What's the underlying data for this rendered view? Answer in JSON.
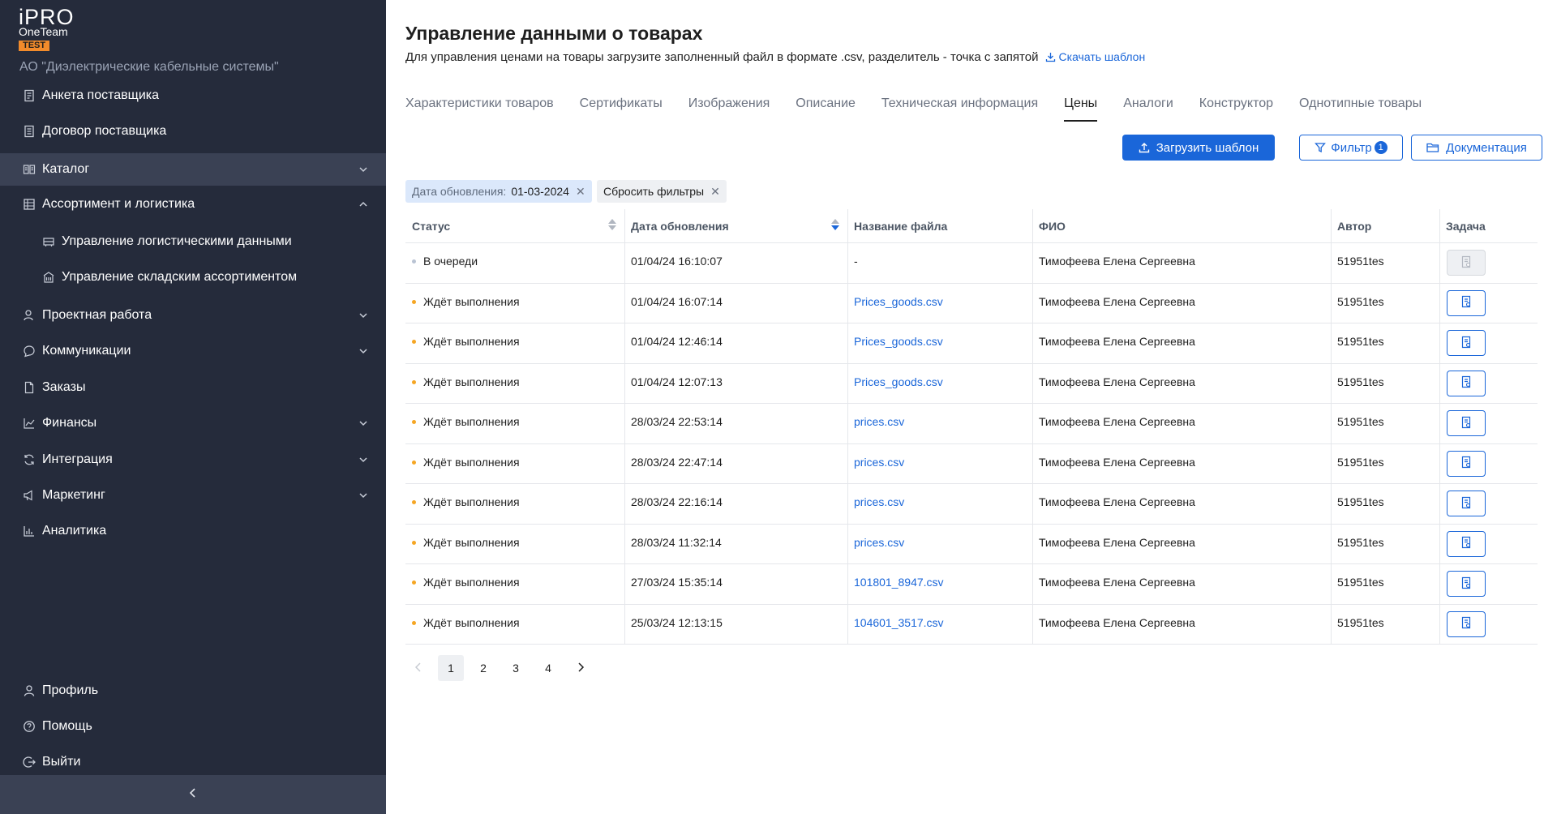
{
  "app": {
    "logo_line1": "iPRO",
    "logo_line2": "OneTeam",
    "logo_badge": "TEST",
    "company": "АО \"Диэлектрические кабельные системы\""
  },
  "sidebar": {
    "items": [
      {
        "label": "Анкета поставщика",
        "icon": "form-icon"
      },
      {
        "label": "Договор поставщика",
        "icon": "contract-icon"
      },
      {
        "label": "Каталог",
        "icon": "catalog-icon",
        "expandable": true,
        "active": true
      },
      {
        "label": "Ассортимент и логистика",
        "icon": "warehouse-icon",
        "expandable": true,
        "expanded": true
      },
      {
        "label": "Управление логистическими данными",
        "icon": "truck-icon",
        "sub": true
      },
      {
        "label": "Управление складским ассортиментом",
        "icon": "building-icon",
        "sub": true
      },
      {
        "label": "Проектная работа",
        "icon": "project-icon",
        "expandable": true
      },
      {
        "label": "Коммуникации",
        "icon": "chat-icon",
        "expandable": true
      },
      {
        "label": "Заказы",
        "icon": "document-icon"
      },
      {
        "label": "Финансы",
        "icon": "finance-icon",
        "expandable": true
      },
      {
        "label": "Интеграция",
        "icon": "sync-icon",
        "expandable": true
      },
      {
        "label": "Маркетинг",
        "icon": "megaphone-icon",
        "expandable": true
      },
      {
        "label": "Аналитика",
        "icon": "bar-chart-icon"
      }
    ],
    "bottom": [
      {
        "label": "Профиль",
        "icon": "user-icon"
      },
      {
        "label": "Помощь",
        "icon": "help-icon"
      },
      {
        "label": "Выйти",
        "icon": "logout-icon"
      }
    ]
  },
  "header": {
    "title": "Управление данными о товарах",
    "subtitle": "Для управления ценами на товары загрузите заполненный файл в формате .csv, разделитель - точка с запятой",
    "download_template": "Скачать шаблон"
  },
  "tabs": [
    {
      "label": "Характеристики товаров"
    },
    {
      "label": "Сертификаты"
    },
    {
      "label": "Изображения"
    },
    {
      "label": "Описание"
    },
    {
      "label": "Техническая информация"
    },
    {
      "label": "Цены",
      "active": true
    },
    {
      "label": "Аналоги"
    },
    {
      "label": "Конструктор"
    },
    {
      "label": "Однотипные товары"
    }
  ],
  "toolbar": {
    "upload_label": "Загрузить шаблон",
    "filter_label": "Фильтр",
    "filter_count": "1",
    "docs_label": "Документация"
  },
  "filters": {
    "chip_key": "Дата обновления:",
    "chip_value": "01-03-2024",
    "reset_label": "Сбросить фильтры"
  },
  "table": {
    "columns": [
      "Статус",
      "Дата обновления",
      "Название файла",
      "ФИО",
      "Автор",
      "Задача"
    ],
    "rows": [
      {
        "status": "В очереди",
        "status_color": "#b9c3d3",
        "date": "01/04/24 16:10:07",
        "file": "-",
        "file_link": false,
        "fio": "Тимофеева Елена Сергеевна",
        "author": "51951tes",
        "task_enabled": false
      },
      {
        "status": "Ждёт выполнения",
        "status_color": "#f5a623",
        "date": "01/04/24 16:07:14",
        "file": "Prices_goods.csv",
        "file_link": true,
        "fio": "Тимофеева Елена Сергеевна",
        "author": "51951tes",
        "task_enabled": true
      },
      {
        "status": "Ждёт выполнения",
        "status_color": "#f5a623",
        "date": "01/04/24 12:46:14",
        "file": "Prices_goods.csv",
        "file_link": true,
        "fio": "Тимофеева Елена Сергеевна",
        "author": "51951tes",
        "task_enabled": true
      },
      {
        "status": "Ждёт выполнения",
        "status_color": "#f5a623",
        "date": "01/04/24 12:07:13",
        "file": "Prices_goods.csv",
        "file_link": true,
        "fio": "Тимофеева Елена Сергеевна",
        "author": "51951tes",
        "task_enabled": true
      },
      {
        "status": "Ждёт выполнения",
        "status_color": "#f5a623",
        "date": "28/03/24 22:53:14",
        "file": "prices.csv",
        "file_link": true,
        "fio": "Тимофеева Елена Сергеевна",
        "author": "51951tes",
        "task_enabled": true
      },
      {
        "status": "Ждёт выполнения",
        "status_color": "#f5a623",
        "date": "28/03/24 22:47:14",
        "file": "prices.csv",
        "file_link": true,
        "fio": "Тимофеева Елена Сергеевна",
        "author": "51951tes",
        "task_enabled": true
      },
      {
        "status": "Ждёт выполнения",
        "status_color": "#f5a623",
        "date": "28/03/24 22:16:14",
        "file": "prices.csv",
        "file_link": true,
        "fio": "Тимофеева Елена Сергеевна",
        "author": "51951tes",
        "task_enabled": true
      },
      {
        "status": "Ждёт выполнения",
        "status_color": "#f5a623",
        "date": "28/03/24 11:32:14",
        "file": "prices.csv",
        "file_link": true,
        "fio": "Тимофеева Елена Сергеевна",
        "author": "51951tes",
        "task_enabled": true
      },
      {
        "status": "Ждёт выполнения",
        "status_color": "#f5a623",
        "date": "27/03/24 15:35:14",
        "file": "101801_8947.csv",
        "file_link": true,
        "fio": "Тимофеева Елена Сергеевна",
        "author": "51951tes",
        "task_enabled": true
      },
      {
        "status": "Ждёт выполнения",
        "status_color": "#f5a623",
        "date": "25/03/24 12:13:15",
        "file": "104601_3517.csv",
        "file_link": true,
        "fio": "Тимофеева Елена Сергеевна",
        "author": "51951tes",
        "task_enabled": true
      }
    ]
  },
  "pagination": {
    "pages": [
      "1",
      "2",
      "3",
      "4"
    ],
    "current": "1"
  },
  "colors": {
    "sidebar_bg": "#252b3b",
    "sidebar_active": "#3a4154",
    "accent": "#1a66d9",
    "badge": "#f28b2b"
  }
}
